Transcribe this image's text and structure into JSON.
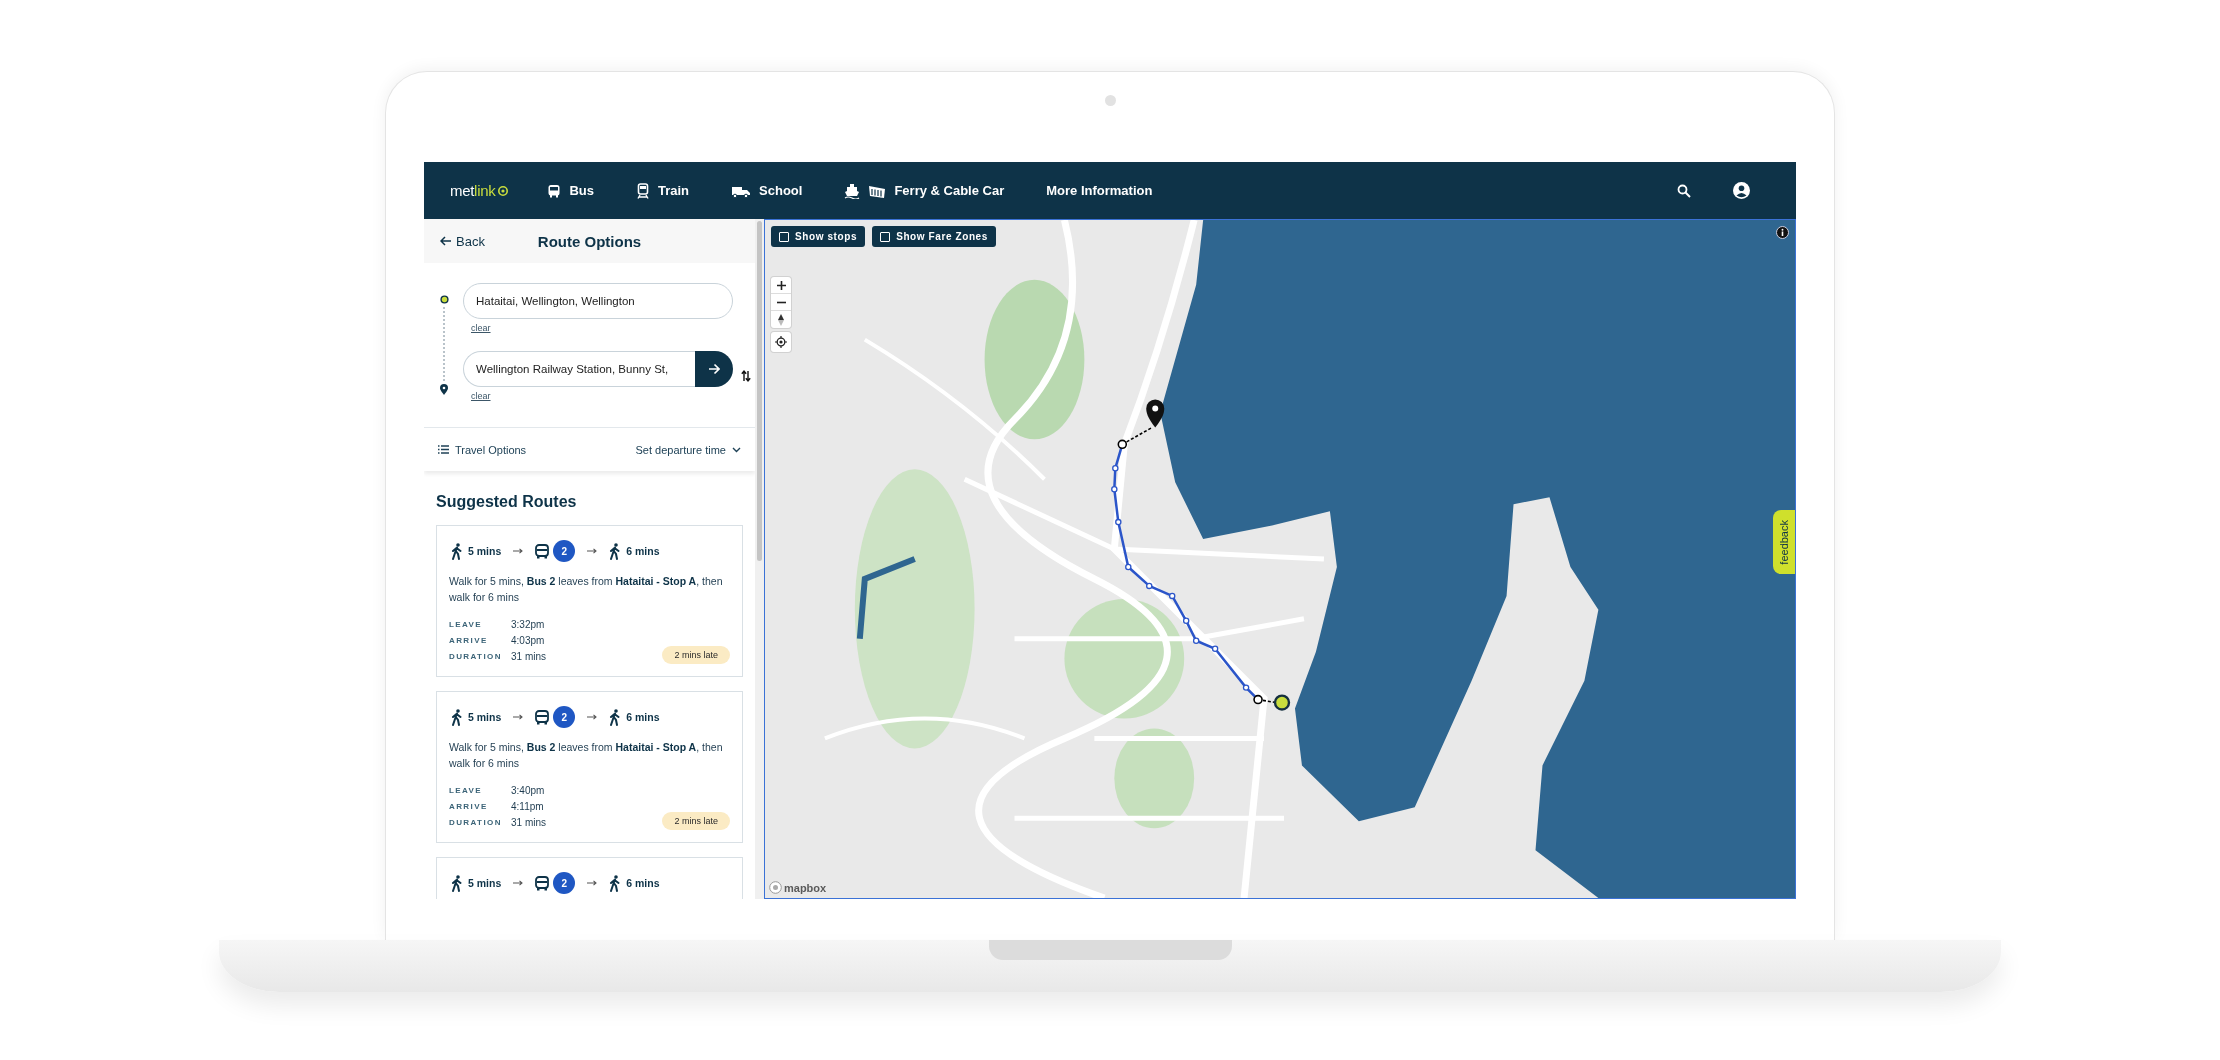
{
  "nav": {
    "logo": {
      "part_1": "met",
      "part_2": "link"
    },
    "items": [
      {
        "label": "Bus",
        "kind": "bus"
      },
      {
        "label": "Train",
        "kind": "train"
      },
      {
        "label": "School",
        "kind": "school"
      },
      {
        "label": "Ferry & Cable Car",
        "kind": "ferry"
      },
      {
        "label": "More Information",
        "kind": "info"
      }
    ]
  },
  "panel": {
    "back": "Back",
    "title": "Route Options",
    "from": {
      "value": "Hataitai, Wellington, Wellington",
      "clear": "clear"
    },
    "to": {
      "value": "Wellington Railway Station, Bunny St,",
      "clear": "clear"
    },
    "travel_options": "Travel Options",
    "departure": "Set departure time",
    "heading": "Suggested Routes",
    "routes": [
      {
        "legs": [
          {
            "kind": "walk",
            "text": "5 mins"
          },
          {
            "kind": "bus",
            "number": "2"
          },
          {
            "kind": "walk",
            "text": "6 mins"
          }
        ],
        "summary": "Walk for 5 mins, **Bus 2** leaves from **Hataitai - Stop A**, then walk for 6 mins",
        "times": [
          {
            "label": "LEAVE",
            "value": "3:32pm"
          },
          {
            "label": "ARRIVE",
            "value": "4:03pm"
          },
          {
            "label": "DURATION",
            "value": "31 mins"
          }
        ],
        "status": "2 mins late"
      },
      {
        "legs": [
          {
            "kind": "walk",
            "text": "5 mins"
          },
          {
            "kind": "bus",
            "number": "2"
          },
          {
            "kind": "walk",
            "text": "6 mins"
          }
        ],
        "summary": "Walk for 5 mins, **Bus 2** leaves from **Hataitai - Stop A**, then walk for 6 mins",
        "times": [
          {
            "label": "LEAVE",
            "value": "3:40pm"
          },
          {
            "label": "ARRIVE",
            "value": "4:11pm"
          },
          {
            "label": "DURATION",
            "value": "31 mins"
          }
        ],
        "status": "2 mins late"
      },
      {
        "legs": [
          {
            "kind": "walk",
            "text": "5 mins"
          },
          {
            "kind": "bus",
            "number": "2"
          },
          {
            "kind": "walk",
            "text": "6 mins"
          }
        ]
      }
    ]
  },
  "map": {
    "toggles": [
      {
        "label": "Show stops",
        "checked": false
      },
      {
        "label": "Show Fare Zones",
        "checked": false
      }
    ],
    "feedback": "feedback",
    "attribution": "mapbox"
  }
}
